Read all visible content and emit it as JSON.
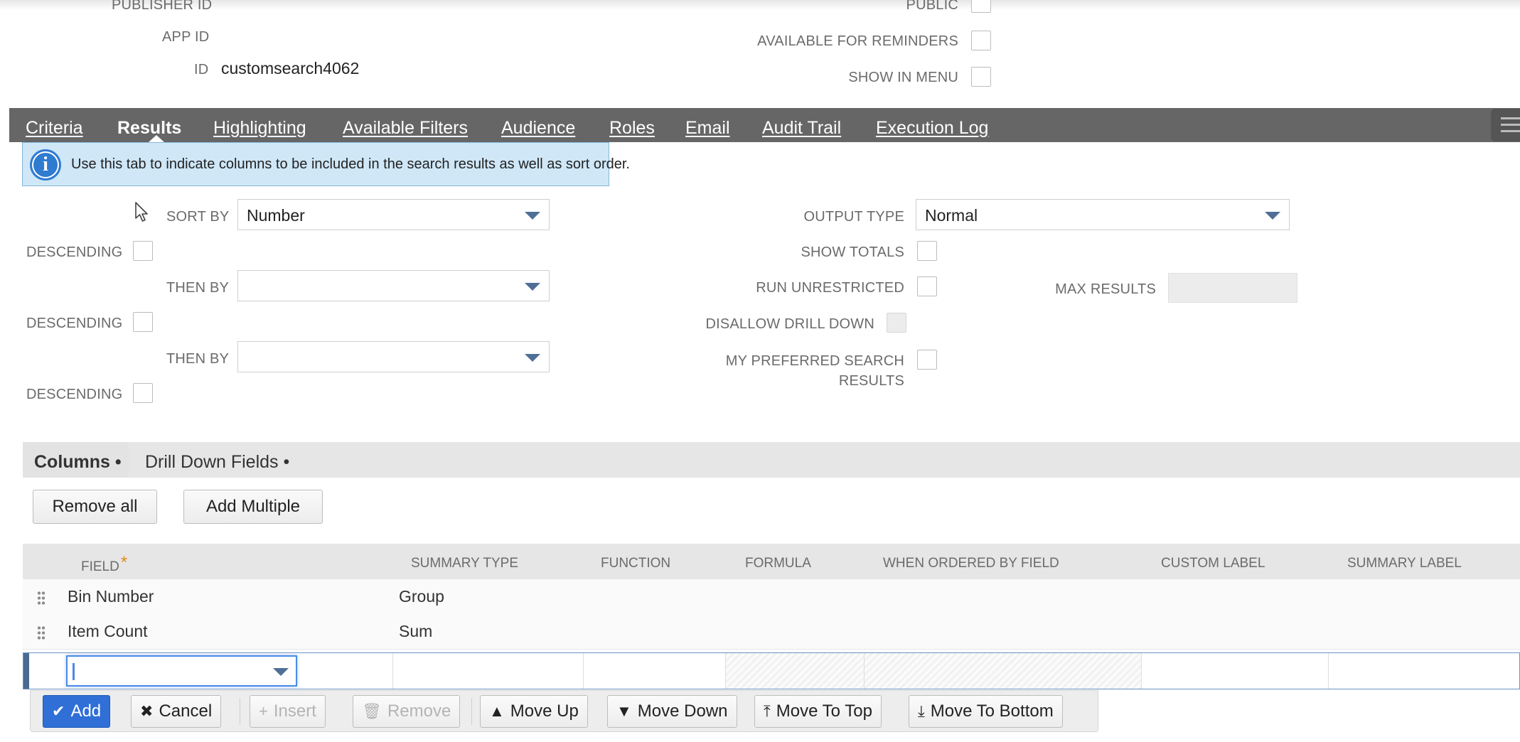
{
  "top_fields": {
    "publisher_id_label": "PUBLISHER ID",
    "app_id_label": "APP ID",
    "id_label": "ID",
    "id_value": "customsearch4062",
    "public_label": "PUBLIC",
    "available_for_reminders_label": "AVAILABLE FOR REMINDERS",
    "show_in_menu_label": "SHOW IN MENU"
  },
  "tabs": [
    {
      "label": "Criteria"
    },
    {
      "label": "Results"
    },
    {
      "label": "Highlighting"
    },
    {
      "label": "Available Filters"
    },
    {
      "label": "Audience"
    },
    {
      "label": "Roles"
    },
    {
      "label": "Email"
    },
    {
      "label": "Audit Trail"
    },
    {
      "label": "Execution Log"
    }
  ],
  "active_tab": "Results",
  "info": {
    "text": "Use this tab to indicate columns to be included in the search results as well as sort order."
  },
  "sort": {
    "sort_by_label": "SORT BY",
    "sort_by_value": "Number",
    "descending_label": "DESCENDING",
    "then_by_label": "THEN BY",
    "then_by_1_value": "",
    "then_by_2_value": ""
  },
  "output": {
    "output_type_label": "OUTPUT TYPE",
    "output_type_value": "Normal",
    "show_totals_label": "SHOW TOTALS",
    "run_unrestricted_label": "RUN UNRESTRICTED",
    "max_results_label": "MAX RESULTS",
    "disallow_drill_down_label": "DISALLOW DRILL DOWN",
    "my_preferred_line1": "MY PREFERRED SEARCH",
    "my_preferred_line2": "RESULTS"
  },
  "subtabs": {
    "columns": "Columns •",
    "drill_down": "Drill Down Fields •"
  },
  "buttons": {
    "remove_all": "Remove all",
    "add_multiple": "Add Multiple"
  },
  "table": {
    "headers": {
      "field": "FIELD",
      "required_mark": "*",
      "summary_type": "SUMMARY TYPE",
      "function": "FUNCTION",
      "formula": "FORMULA",
      "when_ordered_by_field": "WHEN ORDERED BY FIELD",
      "custom_label": "CUSTOM LABEL",
      "summary_label": "SUMMARY LABEL"
    },
    "rows": [
      {
        "field": "Bin Number",
        "summary_type": "Group"
      },
      {
        "field": "Item Count",
        "summary_type": "Sum"
      }
    ]
  },
  "actions": {
    "add": "Add",
    "cancel": "Cancel",
    "insert": "Insert",
    "remove": "Remove",
    "move_up": "Move Up",
    "move_down": "Move Down",
    "move_to_top": "Move To Top",
    "move_to_bottom": "Move To Bottom"
  },
  "colors": {
    "tab_bar": "#666666",
    "primary_button": "#2f6fd6",
    "info_bg": "#cfe7f7"
  }
}
